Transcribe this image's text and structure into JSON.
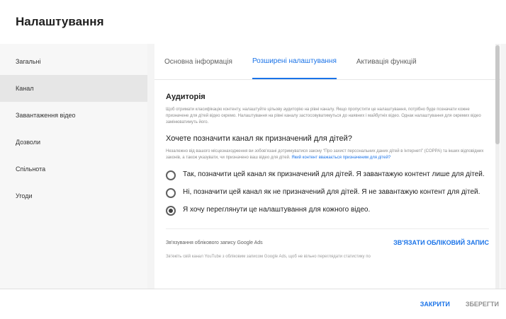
{
  "dialog": {
    "title": "Налаштування"
  },
  "sidebar": {
    "items": [
      {
        "label": "Загальні"
      },
      {
        "label": "Канал"
      },
      {
        "label": "Завантаження відео"
      },
      {
        "label": "Дозволи"
      },
      {
        "label": "Спільнота"
      },
      {
        "label": "Угоди"
      }
    ],
    "active_index": 1
  },
  "tabs": [
    {
      "label": "Основна інформація"
    },
    {
      "label": "Розширені налаштування"
    },
    {
      "label": "Активація функцій"
    }
  ],
  "audience": {
    "heading": "Аудиторія",
    "description": "Щоб отримати класифікацію контенту, налаштуйте цільову аудиторію на рівні каналу. Якщо пропустити це налаштування, потрібно буде позначати кожне призначене для дітей відео окремо. Налаштування на рівні каналу застосовуватимуться до наявних і майбутніх відео. Однак налаштування для окремих відео замінюватимуть його.",
    "question": "Хочете позначити канал як призначений для дітей?",
    "legal": "Незалежно від вашого місцезнаходження ви зобов'язані дотримуватися закону “Про захист персональних даних дітей в Інтернеті” (COPPA) та інших відповідних законів, а також указувати, чи призначено ваш відео для дітей.",
    "legal_link": "Який контент вважається призначеним для дітей?",
    "options": [
      {
        "label": "Так, позначити цей канал як призначений для дітей. Я завантажую контент лише для дітей.",
        "checked": false
      },
      {
        "label": "Ні, позначити цей канал як не призначений для дітей. Я не завантажую контент для дітей.",
        "checked": false
      },
      {
        "label": "Я хочу переглянути це налаштування для кожного відео.",
        "checked": true
      }
    ]
  },
  "google_ads": {
    "label": "Зв'язування облікового запису Google Ads",
    "link_button": "ЗВ'ЯЗАТИ ОБЛІКОВИЙ ЗАПИС",
    "note": "Зв'яжіть свій канал YouTube з обліковим записом Google Ads, щоб не вільно переглядати статистику по"
  },
  "footer": {
    "close_label": "ЗАКРИТИ",
    "save_label": "ЗБЕРЕГТИ"
  },
  "colors": {
    "accent": "#1a73e8",
    "sidebar_bg": "#f7f7f7",
    "sidebar_active": "#e6e6e6"
  }
}
